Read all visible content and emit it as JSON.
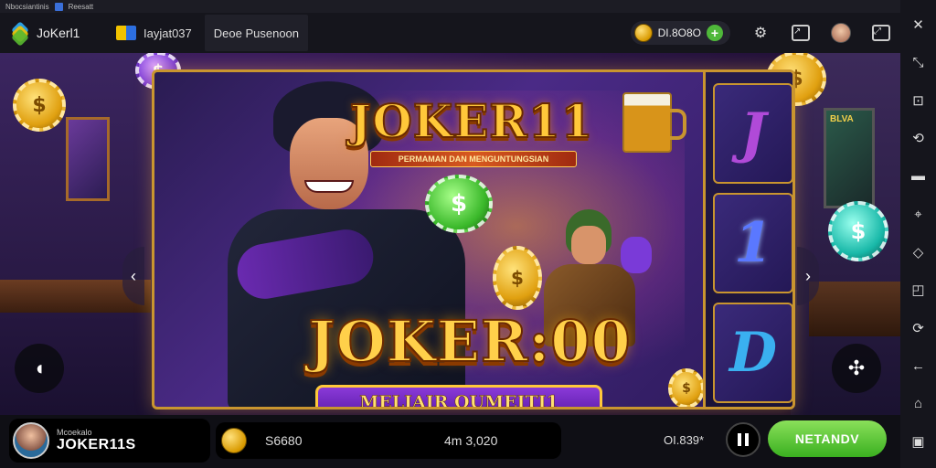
{
  "window": {
    "title": "Nbocsiantinis",
    "tab": "Reesatt"
  },
  "toolbar": {
    "brand": "JoKerl1",
    "account": "Iayjat037",
    "button": "Deoe Pusenoon",
    "coins": "DI.8O8O"
  },
  "game": {
    "title": "JOKER11",
    "subtitle": "PERMAMAN DAN MENGUNTUNGSIAN",
    "big_title": "JOKER:00",
    "banner": "MELIAIR OUMEITI1",
    "poster_text": "BLVA",
    "chip_symbol": "$",
    "tiles": [
      "J",
      "1",
      "D"
    ]
  },
  "bottombar": {
    "player_label": "Mcoekalo",
    "player_name": "JOKER11S",
    "balance": "S6680",
    "win": "4m 3,020",
    "credit": "OI.839*",
    "play_label": "NETANDV"
  },
  "colors": {
    "accent_gold": "#c9952f",
    "play_green": "#3ab020"
  },
  "icons": {
    "toolbar": [
      "settings-icon",
      "screenshot-icon",
      "user-icon",
      "fullscreen-icon"
    ],
    "sidebar": [
      "expand-icon",
      "layout-icon",
      "rotate-icon",
      "minimize-icon",
      "shake-icon",
      "volume-icon",
      "record-icon",
      "camera-icon",
      "back-icon",
      "home-icon",
      "recent-apps-icon"
    ]
  }
}
